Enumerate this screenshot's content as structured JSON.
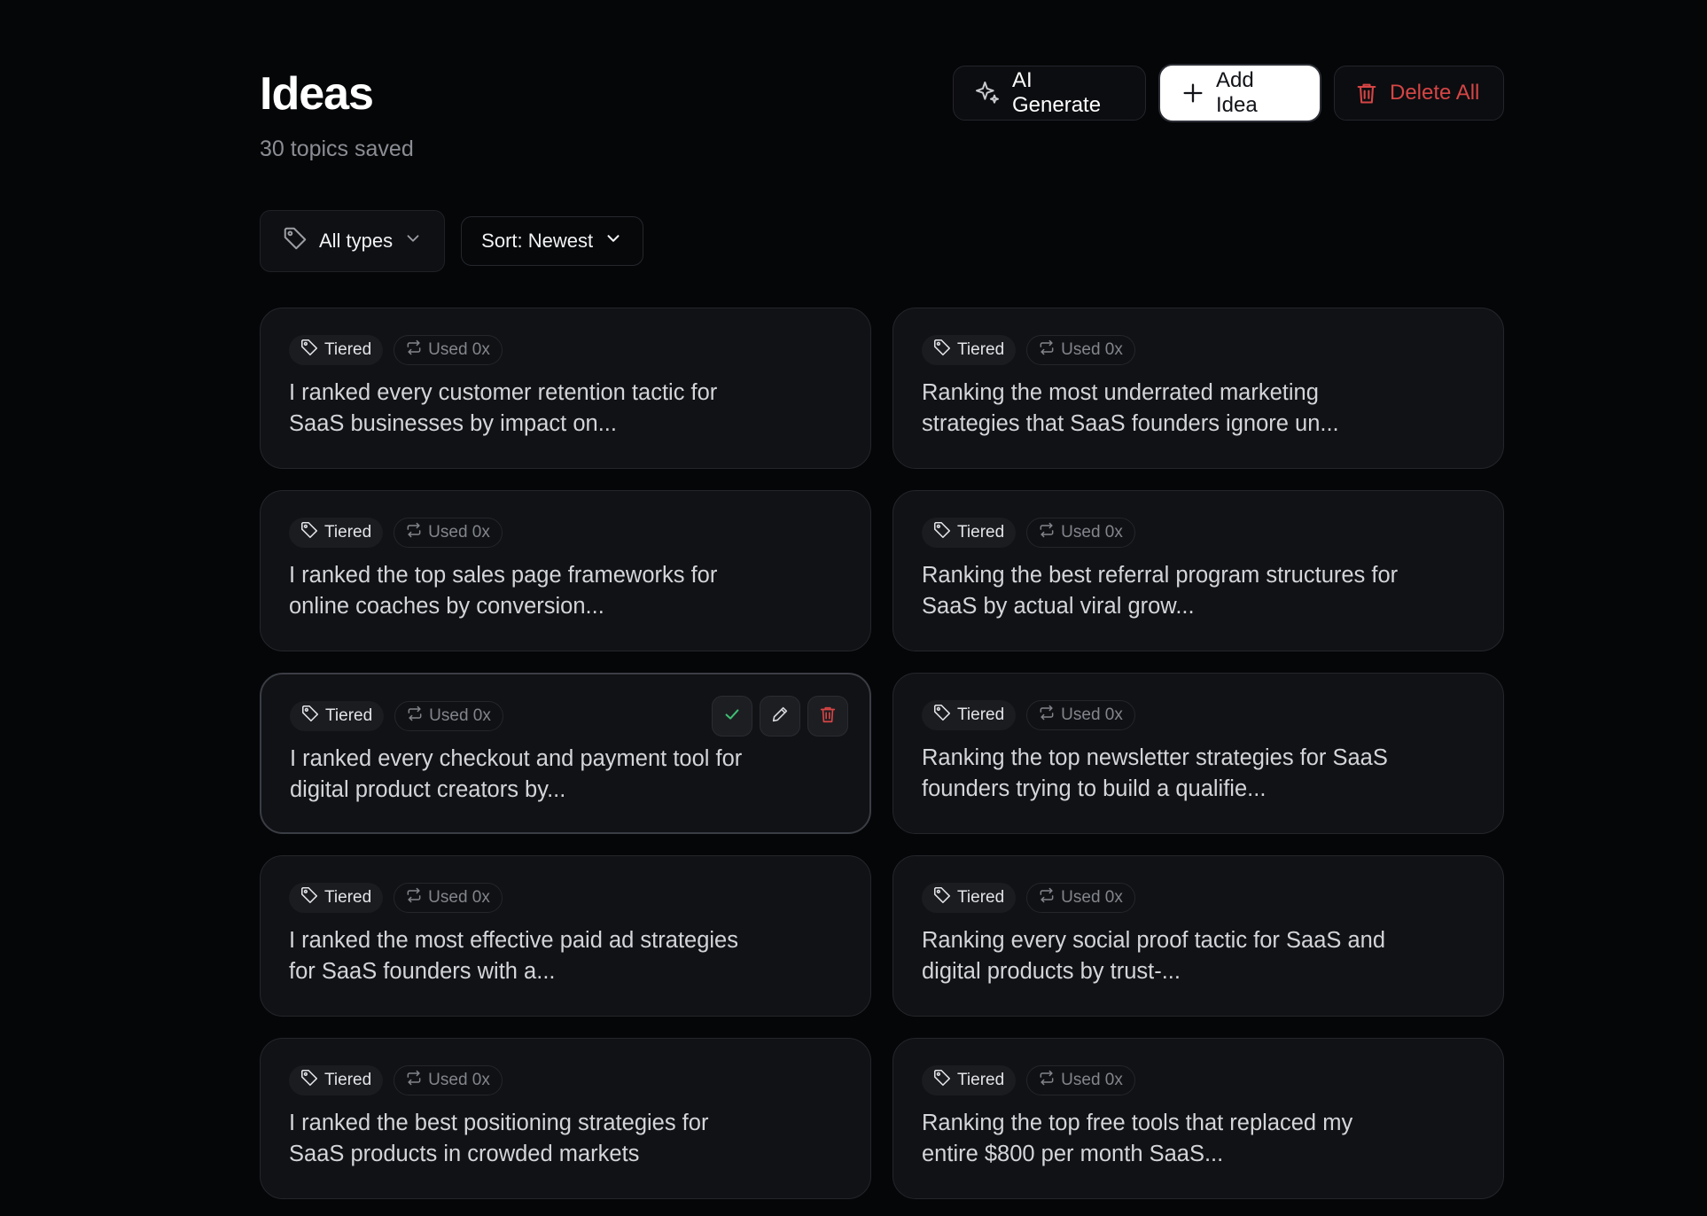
{
  "header": {
    "title": "Ideas",
    "subtitle": "30 topics saved",
    "ai_generate_label": "AI Generate",
    "add_idea_label": "Add Idea",
    "delete_all_label": "Delete All"
  },
  "filters": {
    "type_label": "All types",
    "sort_label": "Sort: Newest"
  },
  "colors": {
    "background": "#050608",
    "card": "#111215",
    "danger": "#d64545",
    "confirm": "#3fbf73"
  },
  "ideas": [
    {
      "type": "Tiered",
      "used": "Used 0x",
      "text": "I ranked every customer retention tactic for SaaS businesses by impact on..."
    },
    {
      "type": "Tiered",
      "used": "Used 0x",
      "text": "Ranking the most underrated marketing strategies that SaaS founders ignore un..."
    },
    {
      "type": "Tiered",
      "used": "Used 0x",
      "text": "I ranked the top sales page frameworks for online coaches by conversion..."
    },
    {
      "type": "Tiered",
      "used": "Used 0x",
      "text": "Ranking the best referral program structures for SaaS by actual viral grow..."
    },
    {
      "type": "Tiered",
      "used": "Used 0x",
      "text": "I ranked every checkout and payment tool for digital product creators by..."
    },
    {
      "type": "Tiered",
      "used": "Used 0x",
      "text": "Ranking the top newsletter strategies for SaaS founders trying to build a qualifie..."
    },
    {
      "type": "Tiered",
      "used": "Used 0x",
      "text": "I ranked the most effective paid ad strategies for SaaS founders with a..."
    },
    {
      "type": "Tiered",
      "used": "Used 0x",
      "text": "Ranking every social proof tactic for SaaS and digital products by trust-..."
    },
    {
      "type": "Tiered",
      "used": "Used 0x",
      "text": "I ranked the best positioning strategies for SaaS products in crowded markets"
    },
    {
      "type": "Tiered",
      "used": "Used 0x",
      "text": "Ranking the top free tools that replaced my entire $800 per month SaaS..."
    }
  ],
  "active_card_index": 4
}
